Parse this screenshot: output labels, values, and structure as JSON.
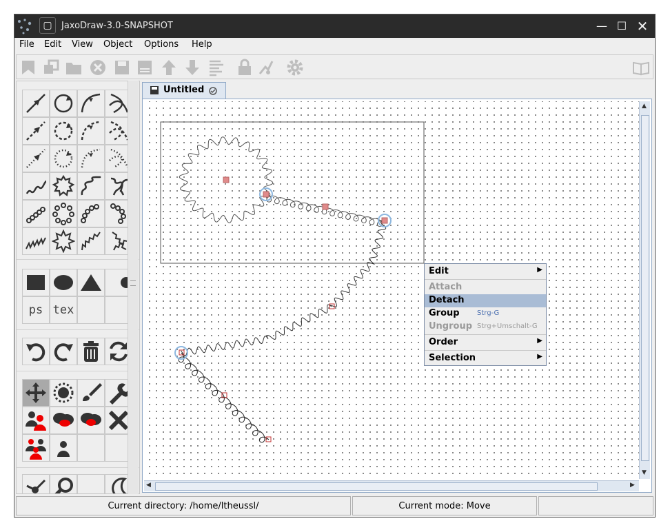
{
  "window": {
    "title": "JaxoDraw-3.0-SNAPSHOT"
  },
  "menubar": [
    "File",
    "Edit",
    "View",
    "Object",
    "Options",
    "Help"
  ],
  "toolbar": {
    "icons": [
      "new-graph-icon",
      "clone-icon",
      "open-folder-icon",
      "close-graph-icon",
      "save-icon",
      "save-as-icon",
      "move-up-icon",
      "move-down-icon",
      "preview-lines-icon",
      "lock-icon",
      "edit-tool-icon",
      "settings-gear-icon",
      "manual-book-icon"
    ]
  },
  "palette": {
    "particle_tools": [
      "fermion-line",
      "fermion-loop",
      "fermion-arc",
      "fermion-bezier",
      "scalar-line",
      "scalar-loop",
      "scalar-arc",
      "scalar-bezier",
      "ghost-line",
      "ghost-loop",
      "ghost-arc",
      "ghost-bezier",
      "photon-line",
      "photon-loop",
      "photon-arc",
      "photon-bezier",
      "gluon-line",
      "gluon-loop",
      "gluon-arc",
      "gluon-bezier",
      "zigzag-line",
      "zigzag-loop",
      "zigzag-arc",
      "zigzag-bezier"
    ],
    "misc_tools": [
      "box",
      "blob",
      "triangle",
      "vertex"
    ],
    "text_tools": {
      "ps": "ps",
      "tex": "tex"
    },
    "action_tools": [
      "undo",
      "redo",
      "delete-all",
      "refresh"
    ],
    "edit_modes": [
      "move",
      "resize",
      "color",
      "edit",
      "duplicate",
      "select-group",
      "unselect-group",
      "delete",
      "select-all",
      "single-object"
    ],
    "extra_tools": [
      "vertex-join",
      "zoom",
      "empty",
      "moon"
    ]
  },
  "tab": {
    "label": "Untitled"
  },
  "context_menu": {
    "items": [
      {
        "label": "Edit",
        "submenu": true,
        "enabled": true
      },
      {
        "label": "Attach",
        "enabled": false
      },
      {
        "label": "Detach",
        "enabled": true,
        "highlighted": true
      },
      {
        "label": "Group",
        "shortcut": "Strg-G",
        "enabled": true
      },
      {
        "label": "Ungroup",
        "shortcut": "Strg+Umschalt-G",
        "enabled": false
      },
      {
        "label": "Order",
        "submenu": true,
        "enabled": true
      },
      {
        "label": "Selection",
        "submenu": true,
        "enabled": true
      }
    ]
  },
  "status": {
    "directory": "Current directory: /home/ltheussl/",
    "mode": "Current mode: Move",
    "extra": ""
  },
  "colors": {
    "titlebar": "#2b2b2b",
    "selection": "#a9bcd5",
    "accent": "#8ea7c6",
    "marker": "#d46a6a"
  }
}
